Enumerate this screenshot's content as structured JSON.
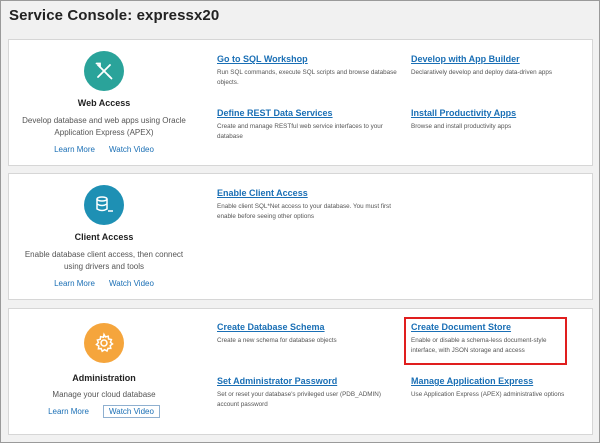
{
  "page": {
    "title": "Service Console: expressx20"
  },
  "colors": {
    "teal": "#2aa39a",
    "blue": "#1e90b4",
    "orange": "#f5a53c",
    "link": "#1a6fb5",
    "highlight": "#e01e1e"
  },
  "web_access": {
    "icon": "tools-icon",
    "title": "Web Access",
    "description": "Develop database and web apps using Oracle Application Express (APEX)",
    "learn_more": "Learn More",
    "watch_video": "Watch Video",
    "items": [
      {
        "title": "Go to SQL Workshop",
        "desc": "Run SQL commands, execute SQL scripts and browse database objects."
      },
      {
        "title": "Develop with App Builder",
        "desc": "Declaratively develop and deploy data-driven apps"
      },
      {
        "title": "Define REST Data Services",
        "desc": "Create and manage RESTful web service interfaces to your database"
      },
      {
        "title": "Install Productivity Apps",
        "desc": "Browse and install productivity apps"
      }
    ]
  },
  "client_access": {
    "icon": "database-terminal-icon",
    "title": "Client Access",
    "description": "Enable database client access, then connect using drivers and tools",
    "learn_more": "Learn More",
    "watch_video": "Watch Video",
    "items": [
      {
        "title": "Enable Client Access",
        "desc": "Enable client SQL*Net access to your database. You must first enable before seeing other options"
      }
    ]
  },
  "administration": {
    "icon": "gear-icon",
    "title": "Administration",
    "description": "Manage your cloud database",
    "learn_more": "Learn More",
    "watch_video": "Watch Video",
    "items": [
      {
        "title": "Create Database Schema",
        "desc": "Create a new schema for database objects"
      },
      {
        "title": "Create Document Store",
        "desc": "Enable or disable a schema-less document-style interface, with JSON storage and access"
      },
      {
        "title": "Set Administrator Password",
        "desc": "Set or reset your database's privileged user (PDB_ADMIN) account password"
      },
      {
        "title": "Manage Application Express",
        "desc": "Use Application Express (APEX) administrative options"
      }
    ]
  }
}
